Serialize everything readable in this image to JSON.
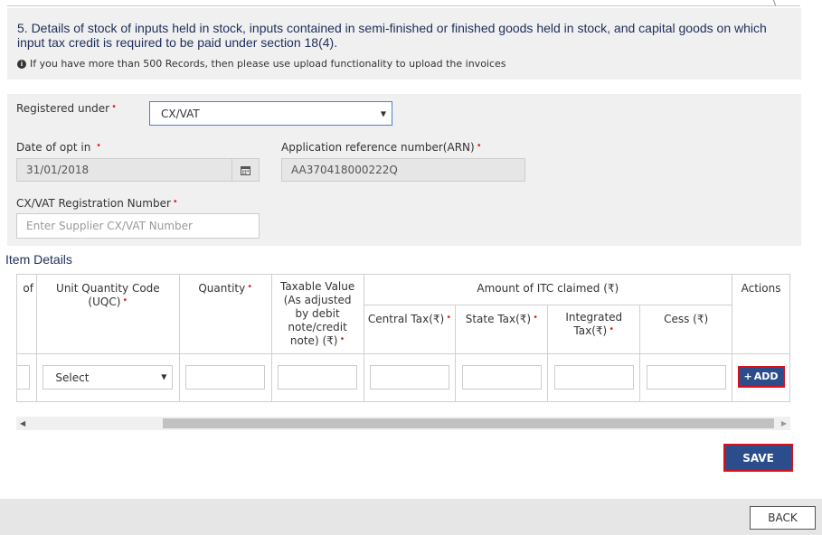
{
  "header": {
    "title": "5. Details of stock of inputs held in stock, inputs contained in semi-finished or finished goods held in stock, and capital goods on which input tax credit is required to be paid under section 18(4).",
    "note": "If you have more than 500 Records, then please use upload functionality to upload the invoices"
  },
  "form": {
    "registered_under_label": "Registered under",
    "registered_under_value": "CX/VAT",
    "date_of_opt_label": "Date of opt in",
    "date_of_opt_value": "31/01/2018",
    "arn_label": "Application reference number(ARN)",
    "arn_value": "AA370418000222Q",
    "cx_vat_reg_label": "CX/VAT Registration Number",
    "cx_vat_reg_placeholder": "Enter Supplier CX/VAT Number",
    "required_mark": "•"
  },
  "items": {
    "section_title": "Item Details",
    "columns": {
      "partial": "of",
      "uqc": "Unit Quantity Code (UQC)",
      "quantity": "Quantity",
      "taxable_value": "Taxable Value (As adjusted by debit note/credit note) (₹)",
      "itc_group": "Amount of ITC claimed (₹)",
      "central_tax": "Central Tax(₹)",
      "state_tax": "State Tax(₹)",
      "integrated_tax": "Integrated Tax(₹)",
      "cess": "Cess (₹)",
      "actions": "Actions"
    },
    "uqc_select_value": "Select",
    "add_button": "ADD",
    "add_icon": "+"
  },
  "buttons": {
    "save": "SAVE",
    "back": "BACK"
  },
  "colors": {
    "primary": "#2b4d8c",
    "highlight_border": "#d8121c",
    "required": "#e0262b",
    "title_text": "#1e2e5a"
  }
}
